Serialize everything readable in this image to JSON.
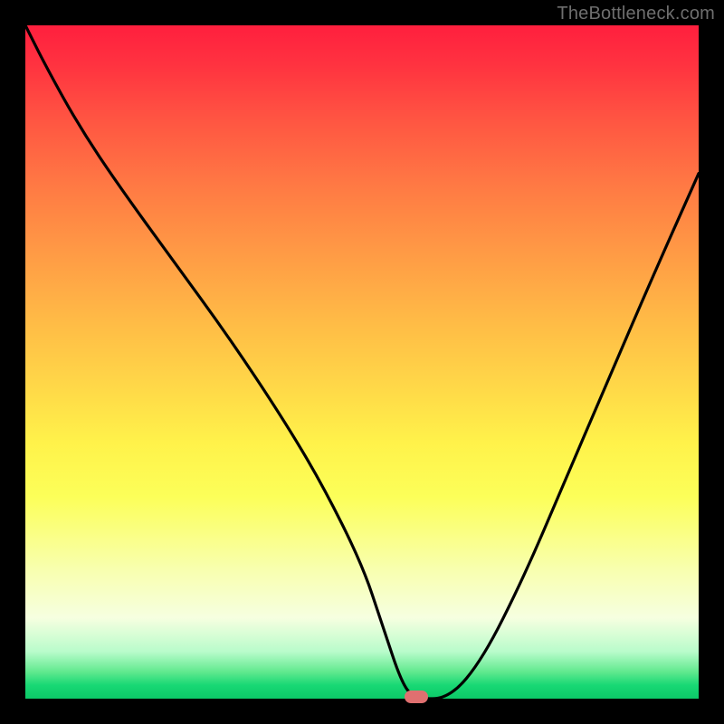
{
  "watermark": "TheBottleneck.com",
  "colors": {
    "frame_bg": "#000000",
    "curve_stroke": "#000000",
    "marker": "#e07070",
    "watermark": "#6e6e6e"
  },
  "chart_data": {
    "type": "line",
    "title": "",
    "xlabel": "",
    "ylabel": "",
    "xlim": [
      0,
      100
    ],
    "ylim": [
      0,
      100
    ],
    "x": [
      0,
      3,
      8,
      14,
      22,
      30,
      38,
      44,
      50,
      53,
      56,
      58,
      63,
      68,
      74,
      80,
      86,
      92,
      100
    ],
    "values": [
      100,
      94,
      85,
      76,
      65,
      54,
      42,
      32,
      20,
      11,
      2,
      0,
      0,
      6,
      18,
      32,
      46,
      60,
      78
    ],
    "marker": {
      "x": 58,
      "y": 0
    },
    "background_gradient": "red-yellow-green (bottleneck heatmap)"
  }
}
